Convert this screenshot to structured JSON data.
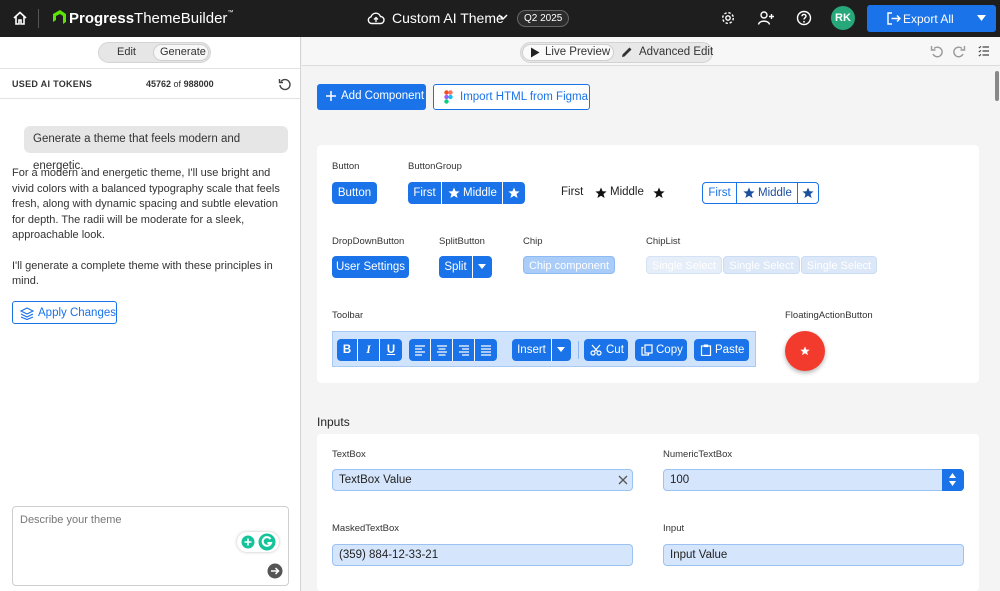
{
  "topbar": {
    "brand_bold": "Progress",
    "brand_rest": "ThemeBuilder",
    "brand_tm": "™",
    "theme_title": "Custom AI Theme",
    "version_badge": "Q2 2025",
    "avatar_initials": "RK",
    "export_label": "Export All"
  },
  "left": {
    "tabs": [
      "Edit",
      "Generate"
    ],
    "active_tab": "Generate",
    "tokens_label": "USED AI TOKENS",
    "tokens_used": "45762",
    "tokens_of": "of",
    "tokens_total": "988000",
    "user_message": "Generate a theme that feels modern and energetic.",
    "reply_p1": "For a modern and energetic theme, I'll use bright and vivid colors with a balanced typography scale that feels fresh, along with dynamic spacing and subtle elevation for depth. The radii will be moderate for a sleek, approachable look.",
    "reply_p2": "I'll generate a complete theme with these principles in mind.",
    "apply_label": "Apply Changes",
    "prompt_placeholder": "Describe your theme"
  },
  "right": {
    "mode_live": "Live Preview",
    "mode_edit": "Advanced Edit",
    "add_component": "Add Component",
    "import_figma": "Import HTML from Figma"
  },
  "buttons_section": {
    "button_label": "Button",
    "button_text": "Button",
    "buttongroup_label": "ButtonGroup",
    "group_first": "First",
    "group_middle": "Middle",
    "dropdown_label": "DropDownButton",
    "dropdown_text": "User Settings",
    "split_label": "SplitButton",
    "split_text": "Split",
    "chip_label": "Chip",
    "chip_text": "Chip component",
    "chiplist_label": "ChipList",
    "chiplist_items": [
      "Single Select",
      "Single Select",
      "Single Select"
    ],
    "toolbar_label": "Toolbar",
    "toolbar_insert": "Insert",
    "toolbar_cut": "Cut",
    "toolbar_copy": "Copy",
    "toolbar_paste": "Paste",
    "fab_label": "FloatingActionButton"
  },
  "inputs_section": {
    "heading": "Inputs",
    "textbox_label": "TextBox",
    "textbox_value": "TextBox Value",
    "numeric_label": "NumericTextBox",
    "numeric_value": "100",
    "masked_label": "MaskedTextBox",
    "masked_value": "(359) 884-12-33-21",
    "input_label": "Input",
    "input_value": "Input Value"
  },
  "colors": {
    "primary": "#1a73e8",
    "topbar": "#1e1e1e",
    "fab": "#f23a2d",
    "avatar": "#27a87a"
  }
}
